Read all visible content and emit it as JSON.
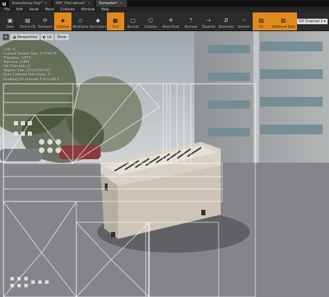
{
  "tabs": [
    {
      "label": "SceneSetup Day*",
      "active": false
    },
    {
      "label": "MAT_FileCabinet*",
      "active": false
    },
    {
      "label": "Dumpster*",
      "active": true
    }
  ],
  "menu": [
    "File",
    "Edit",
    "Asset",
    "Mesh",
    "Collision",
    "Window",
    "Help"
  ],
  "toolbar": [
    {
      "label": "Save",
      "icon": "save-icon",
      "active": false
    },
    {
      "label": "Find in CB",
      "icon": "find-icon",
      "active": false
    },
    {
      "label": "Reimport",
      "icon": "reimport-icon",
      "active": false
    },
    {
      "label": "Collision",
      "icon": "collision-icon",
      "active": true
    },
    {
      "label": "Wireframe",
      "icon": "wireframe-icon",
      "active": false
    },
    {
      "label": "Vert Colors",
      "icon": "vert-colors-icon",
      "active": false
    },
    {
      "label": "Grid",
      "icon": "grid-icon",
      "active": true
    },
    {
      "label": "Bounds",
      "icon": "bounds-icon",
      "active": false
    },
    {
      "label": "Collision",
      "icon": "collision-view-icon",
      "active": false
    },
    {
      "label": "Show Pivot",
      "icon": "pivot-icon",
      "active": false
    },
    {
      "label": "Normals",
      "icon": "normals-icon",
      "active": false
    },
    {
      "label": "Tangents",
      "icon": "tangents-icon",
      "active": false
    },
    {
      "label": "Binormals",
      "icon": "binormals-icon",
      "active": false
    },
    {
      "label": "Vertices",
      "icon": "vertices-icon",
      "active": false
    },
    {
      "label": "UV",
      "icon": "uv-icon",
      "active": true
    },
    {
      "label": "Additional Data",
      "icon": "additional-data-icon",
      "active": true
    }
  ],
  "uv_channel_select": "UV Channel 1",
  "viewport": {
    "perspective": "Perspective",
    "lit": "Lit",
    "show": "Show"
  },
  "stats": [
    "LOD: 0",
    "Current Screen Size: 0.774175",
    "Triangles: 1,672",
    "Vertices: 2,464",
    "UV Channels: 2",
    "Approx Size: 223x150x193",
    "Num Collision Primitives: 0"
  ],
  "uv_info": "Showing UV channel 1 for LOD 0",
  "colors": {
    "accent": "#e08a1f",
    "sky": "#c7ccd0",
    "floor": "#808085",
    "wireframe": "#ffffff"
  }
}
